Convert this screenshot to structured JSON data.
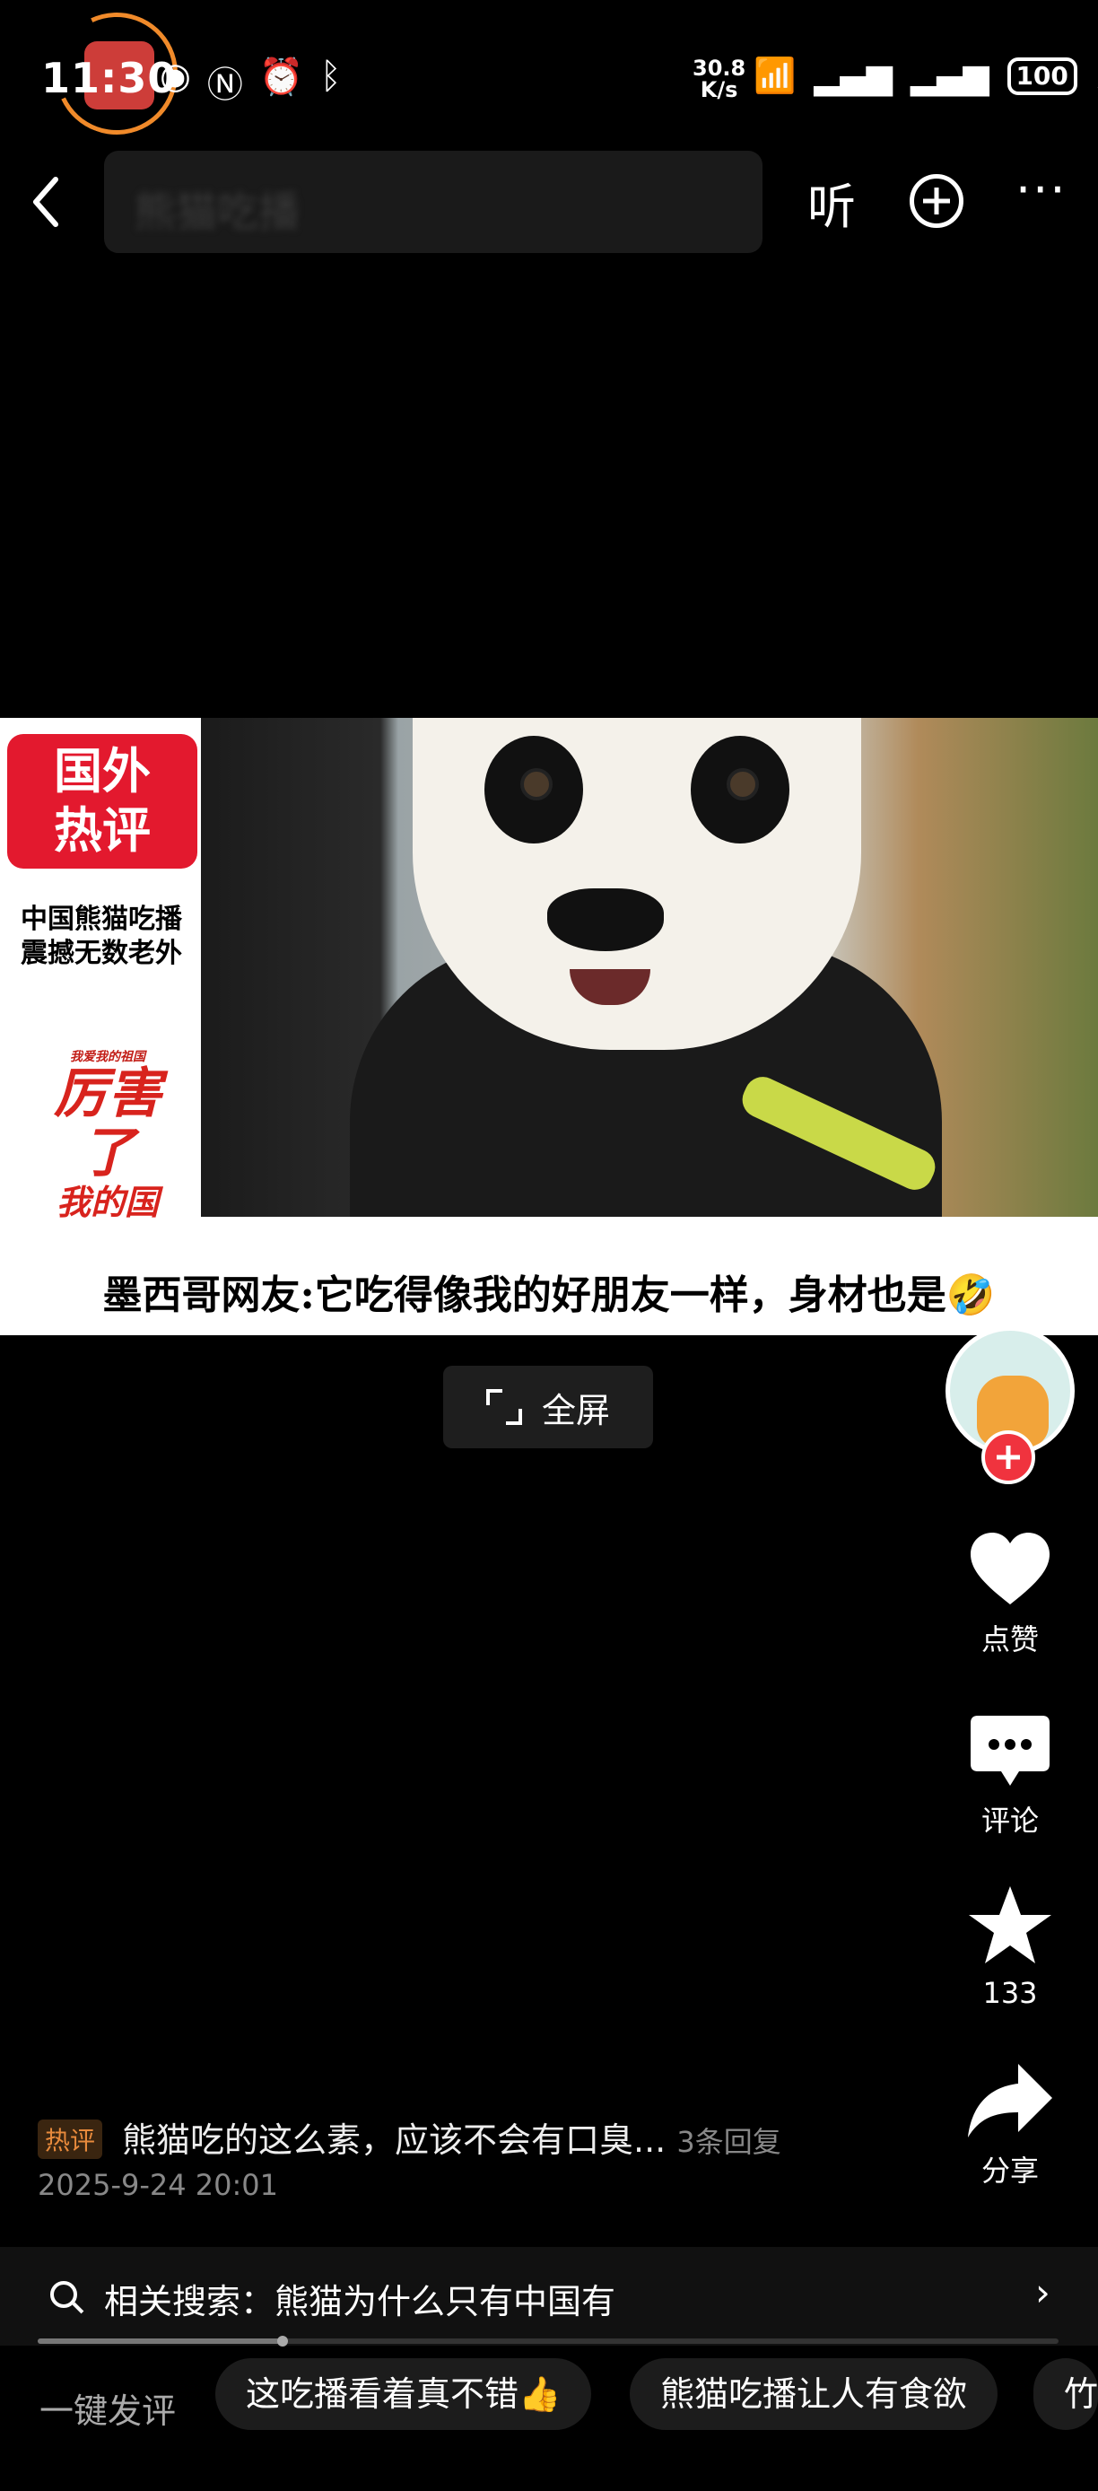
{
  "status_bar": {
    "time": "11:30",
    "netspeed_value": "30.8",
    "netspeed_unit": "K/s",
    "battery": "100"
  },
  "top_bar": {
    "search_text": "熊猫吃播",
    "listen_label": "听",
    "more_label": "···"
  },
  "video": {
    "badge_line1": "国外",
    "badge_line2": "热评",
    "side_line1": "中国熊猫吃播",
    "side_line2": "震撼无数老外",
    "calli_small": "我爱我的祖国",
    "calli_big": "厉害了",
    "calli_line3": "我的国",
    "caption": "墨西哥网友:它吃得像我的好朋友一样，身材也是🤣",
    "fullscreen_label": "全屏"
  },
  "rail": {
    "like_label": "点赞",
    "comment_label": "评论",
    "favorite_count": "133",
    "share_label": "分享"
  },
  "comment": {
    "tag": "热评",
    "text": "熊猫吃的这么素，应该不会有口臭...",
    "reply_count": "3条回复",
    "time": "2025-9-24 20:01"
  },
  "related": {
    "text": "相关搜索：熊猫为什么只有中国有",
    "progress": 0.24
  },
  "quick_reply": {
    "label": "一键发评",
    "chips": [
      "这吃播看着真不错👍",
      "熊猫吃播让人有食欲",
      "竹"
    ]
  },
  "colors": {
    "accent_red": "#f0333e",
    "hot_tag": "#e88a3c",
    "badge_red": "#e3192e"
  }
}
